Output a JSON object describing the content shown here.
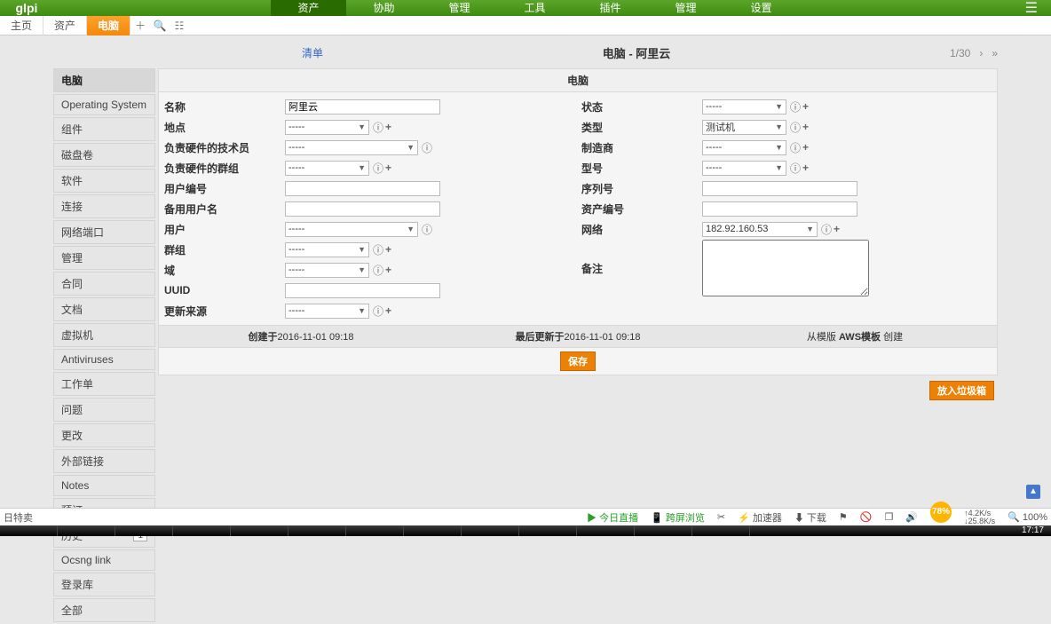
{
  "topnav": {
    "logo": "glpi",
    "items": [
      "资产",
      "协助",
      "管理",
      "工具",
      "插件",
      "管理",
      "设置"
    ],
    "activeIndex": 0
  },
  "crumbs": {
    "items": [
      "主页",
      "资产",
      "电脑"
    ],
    "activeIndex": 2
  },
  "pager": {
    "list_label": "清单",
    "title": "电脑 - 阿里云",
    "pos": "1/30"
  },
  "sidemenu": {
    "items": [
      "电脑",
      "Operating System",
      "组件",
      "磁盘卷",
      "软件",
      "连接",
      "网络端口",
      "管理",
      "合同",
      "文档",
      "虚拟机",
      "Antiviruses",
      "工作单",
      "问题",
      "更改",
      "外部链接",
      "Notes",
      "预订",
      "历史",
      "Ocsng link",
      "登录库",
      "全部"
    ],
    "activeIndex": 0,
    "history_count": "1"
  },
  "form": {
    "group_title": "电脑",
    "labels": {
      "name": "名称",
      "status": "状态",
      "location": "地点",
      "type": "类型",
      "techuser": "负责硬件的技术员",
      "maker": "制造商",
      "techgroup": "负责硬件的群组",
      "model": "型号",
      "usernum": "用户编号",
      "serial": "序列号",
      "altuser": "备用用户名",
      "assetnum": "资产编号",
      "user": "用户",
      "network": "网络",
      "group": "群组",
      "remark": "备注",
      "domain": "域",
      "uuid": "UUID",
      "updatesrc": "更新来源"
    },
    "values": {
      "name": "阿里云",
      "type": "测试机",
      "network": "182.92.160.53",
      "dash": "-----",
      "status": "",
      "location": "",
      "techuser": "",
      "maker": "",
      "techgroup": "",
      "model": "",
      "usernum": "",
      "serial": "",
      "altuser": "",
      "assetnum": "",
      "user": "",
      "group": "",
      "domain": "",
      "uuid": "",
      "updatesrc": "",
      "remark": ""
    },
    "meta": {
      "created_label": "创建于",
      "created_val": "2016-11-01 09:18",
      "updated_label": "最后更新于",
      "updated_val": "2016-11-01 09:18",
      "from_tpl_prefix": "从模版 ",
      "from_tpl_name": "AWS模板",
      "from_tpl_suffix": " 创建"
    },
    "buttons": {
      "save": "保存",
      "trash": "放入垃圾箱"
    }
  },
  "status": {
    "left": "日特卖",
    "live": "今日直播",
    "browser": "跨屏浏览",
    "accel": "加速器",
    "download": "下载",
    "net_pct": "78%",
    "up": "4.2K/s",
    "down": "25.8K/s",
    "zoom": "100%"
  },
  "clock": "17:17"
}
